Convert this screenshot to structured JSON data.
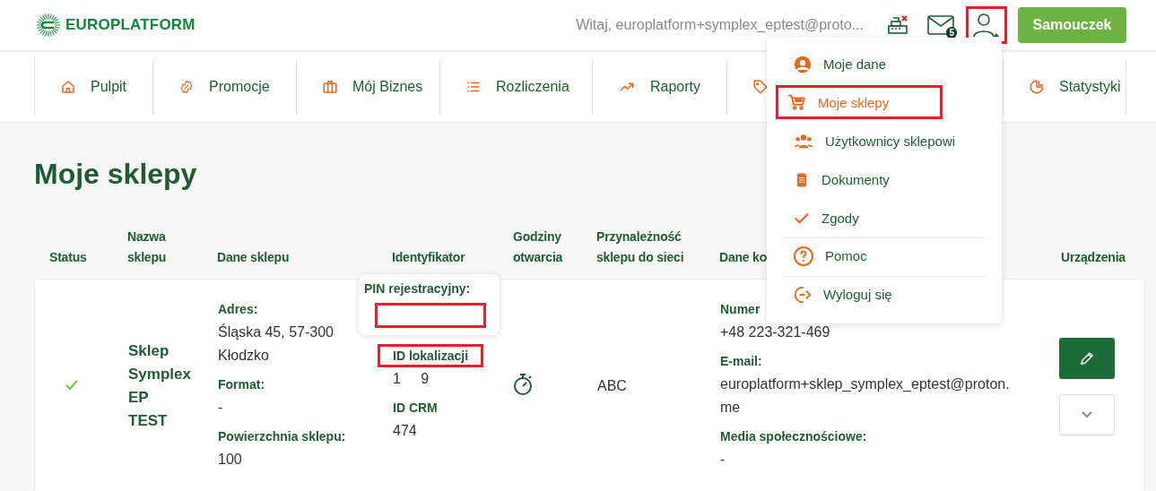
{
  "header": {
    "logo": "EUROPLATFORM",
    "greeting": "Witaj, europlatform+symplex_eptest@proto...",
    "message_count": "5",
    "user_highlighted": true,
    "tutorial_button": "Samouczek"
  },
  "nav": [
    {
      "kind": "link",
      "label": "Pulpit"
    },
    {
      "kind": "link",
      "label": "Promocje"
    },
    {
      "kind": "link",
      "label": "Mój Biznes"
    },
    {
      "kind": "link",
      "label": "Rozliczenia"
    },
    {
      "kind": "link",
      "label": "Raporty"
    },
    {
      "kind": "icon"
    },
    {
      "kind": "link",
      "label": "Statystyki"
    }
  ],
  "user_menu": [
    {
      "label": "Moje dane",
      "selected": false,
      "highlighted": false,
      "separated": false
    },
    {
      "label": "Moje sklepy",
      "selected": true,
      "highlighted": true,
      "separated": false
    },
    {
      "label": "Użytkownicy sklepowi",
      "selected": false,
      "highlighted": false,
      "separated": false
    },
    {
      "label": "Dokumenty",
      "selected": false,
      "highlighted": false,
      "separated": false
    },
    {
      "label": "Zgody",
      "selected": false,
      "highlighted": false,
      "separated": false
    },
    {
      "label": "Pomoc",
      "selected": false,
      "highlighted": false,
      "separated": true
    },
    {
      "label": "Wyloguj się",
      "selected": false,
      "highlighted": false,
      "separated": true
    }
  ],
  "page_title": "Moje sklepy",
  "table": {
    "columns": [
      "Status",
      "Nazwa sklepu",
      "Dane sklepu",
      "Identyfikator",
      "Godziny otwarcia",
      "Przynależność sklepu do sieci",
      "Dane ko",
      "Urządzenia"
    ],
    "rows": [
      {
        "active": true,
        "name": "Sklep Symplex EP TEST",
        "details": [
          {
            "label": "Adres:",
            "value": "Śląska 45, 57-300 Kłodzko"
          },
          {
            "label": "Format:",
            "value": "-"
          },
          {
            "label": "Powierzchnia sklepu:",
            "value": "100"
          }
        ],
        "pin_label": "PIN rejestracyjny:",
        "pin_highlighted": true,
        "identifiers": [
          {
            "label": "ID lokalizacji",
            "value": "1     9",
            "highlighted": true
          },
          {
            "label": "ID CRM",
            "value": "474",
            "highlighted": false
          }
        ],
        "network": "ABC",
        "contact": [
          {
            "label": "Numer",
            "value": "+48 223-321-469"
          },
          {
            "label": "E-mail:",
            "value": "europlatform+sklep_symplex_eptest@proton.me"
          },
          {
            "label": "Media społecznościowe:",
            "value": "-"
          }
        ]
      }
    ]
  }
}
